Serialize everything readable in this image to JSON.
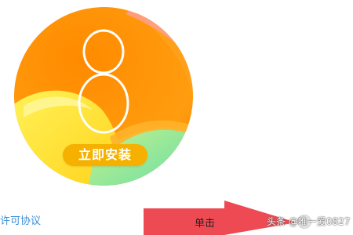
{
  "logo": {
    "digit": "8"
  },
  "install_button": {
    "label": "立即安装"
  },
  "license_link": {
    "label": "许可协议"
  },
  "annotation": {
    "click_label": "单击"
  },
  "watermark": {
    "text": "头条 @唯一爱0827"
  },
  "colors": {
    "accent_orange": "#f6b100",
    "link_blue": "#3d8fd6",
    "arrow_red": "#ee4a54"
  },
  "icons": {
    "logo": "colorful-circle-8-logo",
    "corner": "circle-icon",
    "arrow": "right-arrow-icon"
  }
}
